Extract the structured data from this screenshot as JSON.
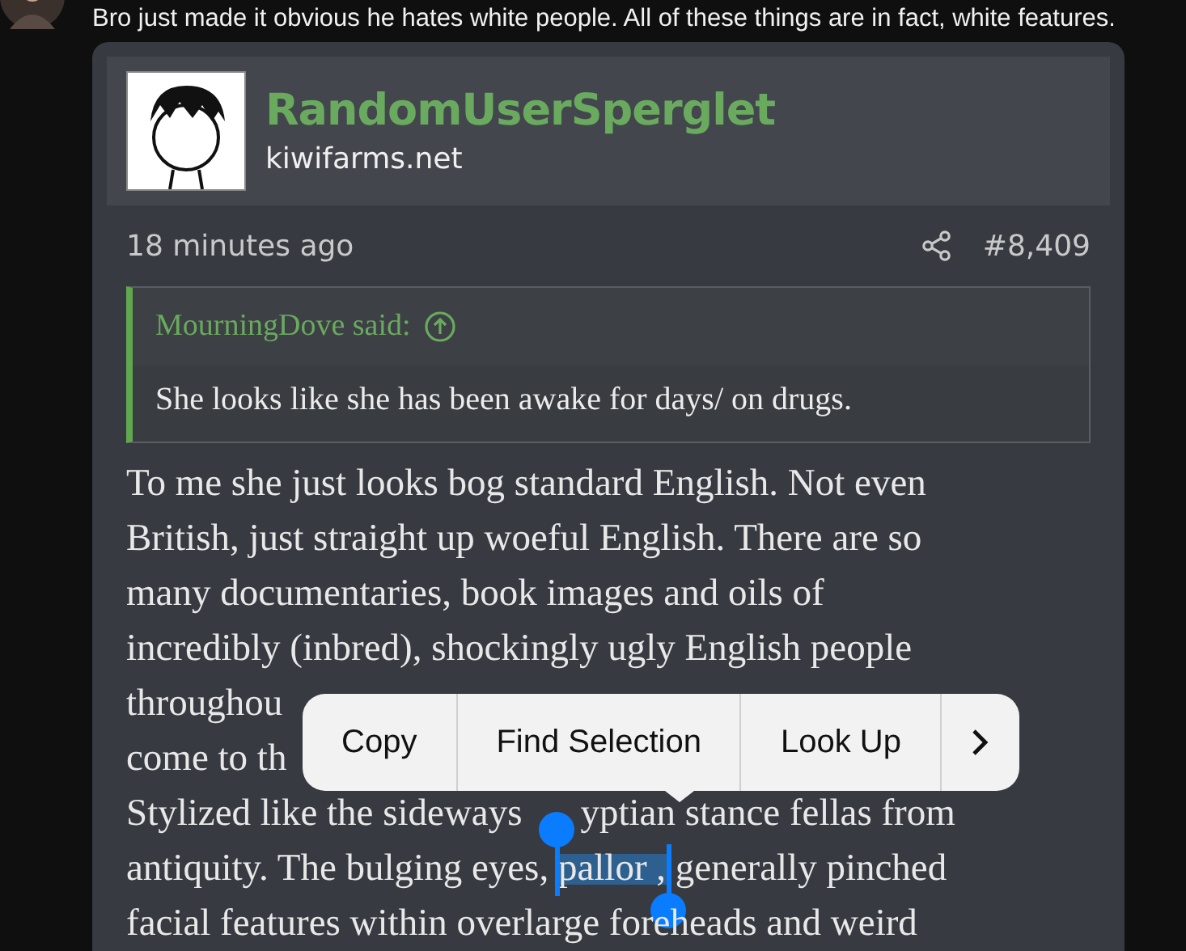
{
  "comment": {
    "text": "Bro just made it obvious he hates white people. All of these things are in fact, white features."
  },
  "post": {
    "author": "RandomUserSperglet",
    "site": "kiwifarms.net",
    "time": "18 minutes ago",
    "number": "#8,409",
    "quote": {
      "header": "MourningDove said:",
      "text": "She looks like she has been awake for days/ on drugs."
    },
    "body_lines": [
      {
        "segments": [
          {
            "text": "To me she just looks bog standard English. Not even",
            "selected": false
          }
        ]
      },
      {
        "segments": [
          {
            "text": "British, just straight up woeful English. There are so",
            "selected": false
          }
        ]
      },
      {
        "segments": [
          {
            "text": "many documentaries, book images and oils of",
            "selected": false
          }
        ]
      },
      {
        "segments": [
          {
            "text": "incredibly (inbred), shockingly ugly English people",
            "selected": false
          }
        ]
      },
      {
        "segments": [
          {
            "text": "throughou",
            "selected": false
          }
        ]
      },
      {
        "segments": [
          {
            "text": "come to th",
            "selected": false
          }
        ]
      },
      {
        "segments": [
          {
            "text": "Stylized like the sideways",
            "selected": false
          },
          {
            "text": "yptian stance fellas from",
            "selected": false
          }
        ]
      },
      {
        "segments": [
          {
            "text": "antiquity. The bulging eyes, ",
            "selected": false
          },
          {
            "text": "pallor ,",
            "selected": true
          },
          {
            "text": " generally pinched",
            "selected": false
          }
        ]
      },
      {
        "segments": [
          {
            "text": "facial features within overlarge foreheads and weird",
            "selected": false
          }
        ]
      }
    ]
  },
  "context_menu": {
    "items": [
      {
        "label": "Copy"
      },
      {
        "label": "Find Selection"
      },
      {
        "label": "Look Up"
      }
    ]
  }
}
